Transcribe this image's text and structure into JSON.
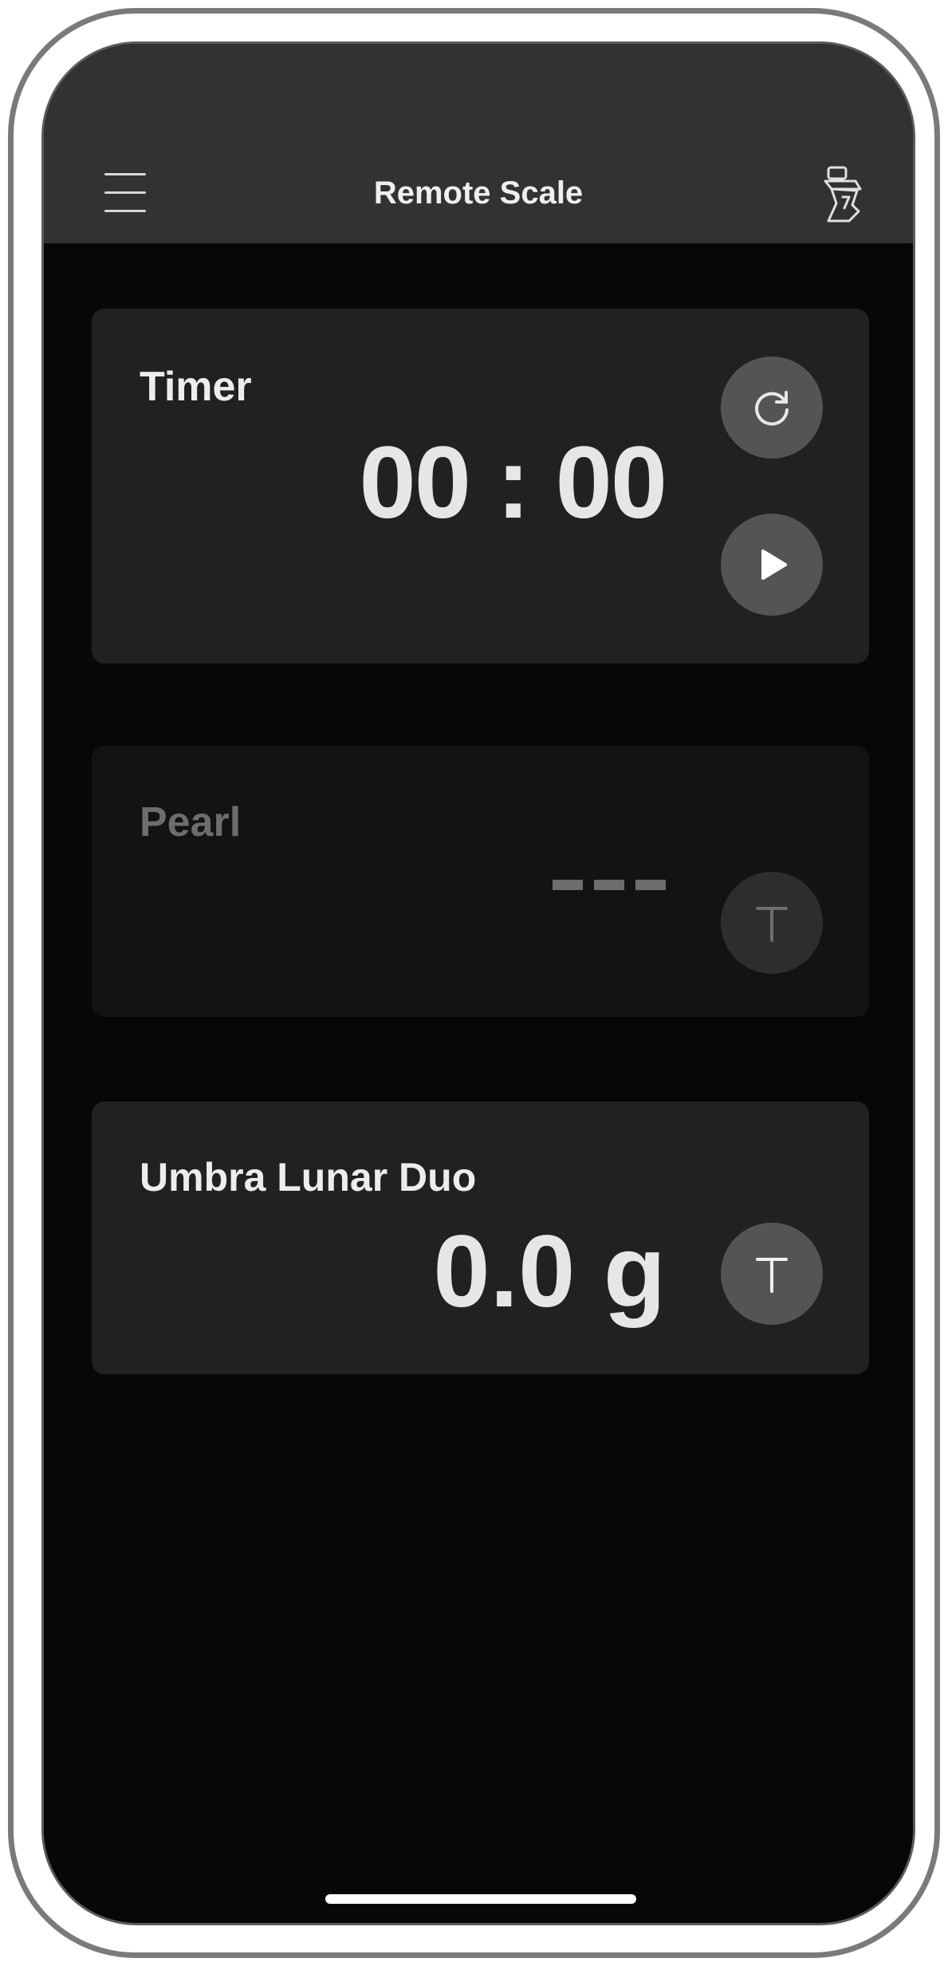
{
  "app": {
    "title": "Remote Scale"
  },
  "icons": {
    "menu": "hamburger-icon",
    "right": "grinder-icon",
    "reset": "refresh-icon",
    "play": "play-icon",
    "tare": "tare-icon"
  },
  "timer": {
    "title": "Timer",
    "value": "00 : 00"
  },
  "pearl": {
    "title": "Pearl",
    "value_placeholder": "---",
    "tare_label": "T"
  },
  "umbra": {
    "title": "Umbra Lunar Duo",
    "value": "0.0 g",
    "tare_label": "T"
  },
  "colors": {
    "background": "#080707",
    "navbar": "#333232",
    "card": "#222121",
    "card_disabled": "#141313",
    "button": "#555454",
    "text": "#e6e6e6",
    "text_disabled": "#6e6d6d"
  }
}
